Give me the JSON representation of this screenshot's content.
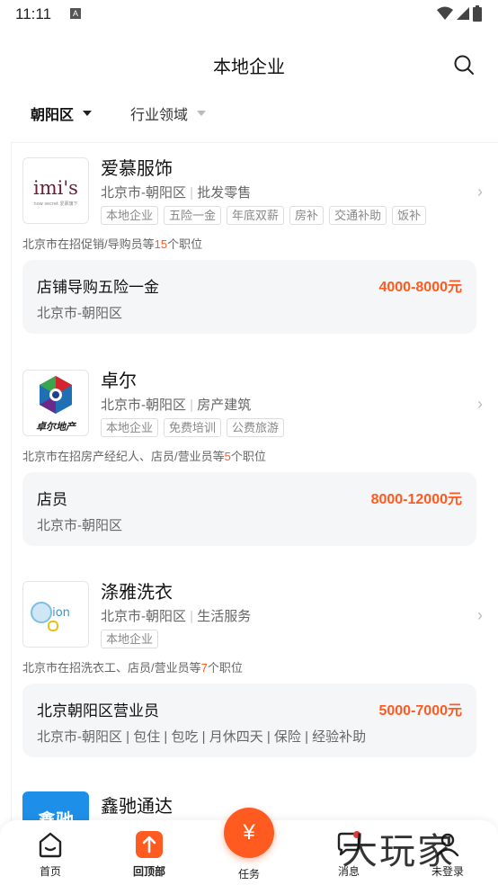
{
  "status": {
    "time": "11:11",
    "a_badge": "A"
  },
  "header": {
    "title": "本地企业"
  },
  "filters": {
    "district": "朝阳区",
    "industry": "行业领域"
  },
  "companies": [
    {
      "name": "爱慕服饰",
      "location": "北京市-朝阳区",
      "industry": "批发零售",
      "tags": [
        "本地企业",
        "五险一金",
        "年底双薪",
        "房补",
        "交通补助",
        "饭补"
      ],
      "hiring_prefix": "北京市在招促销/导购员等",
      "hiring_count": "15",
      "hiring_suffix": "个职位",
      "job": {
        "title": "店铺导购五险一金",
        "salary": "4000-8000元",
        "location": "北京市-朝阳区"
      },
      "logo_text": "imi's",
      "logo_sub": "now secret 爱慕旗下"
    },
    {
      "name": "卓尔",
      "location": "北京市-朝阳区",
      "industry": "房产建筑",
      "tags": [
        "本地企业",
        "免费培训",
        "公费旅游"
      ],
      "hiring_prefix": "北京市在招房产经纪人、店员/营业员等",
      "hiring_count": "5",
      "hiring_suffix": "个职位",
      "job": {
        "title": "店员",
        "salary": "8000-12000元",
        "location": "北京市-朝阳区"
      },
      "logo_text": "卓尔地产"
    },
    {
      "name": "涤雅洗衣",
      "location": "北京市-朝阳区",
      "industry": "生活服务",
      "tags": [
        "本地企业"
      ],
      "hiring_prefix": "北京市在招洗衣工、店员/营业员等",
      "hiring_count": "7",
      "hiring_suffix": "个职位",
      "job": {
        "title": "北京朝阳区营业员",
        "salary": "5000-7000元",
        "location": "北京市-朝阳区 | 包住 | 包吃 | 月休四天 | 保险 | 经验补助"
      },
      "logo_text": "ion"
    },
    {
      "name": "鑫驰通达",
      "logo_text": "鑫驰"
    }
  ],
  "tabbar": {
    "home": "首页",
    "top": "回顶部",
    "task": "任务",
    "task_symbol": "¥",
    "msg": "消息",
    "login": "未登录"
  },
  "watermark": "大玩家",
  "colors": {
    "accent": "#ff5a1f",
    "card_bg": "#f5f6f8"
  }
}
